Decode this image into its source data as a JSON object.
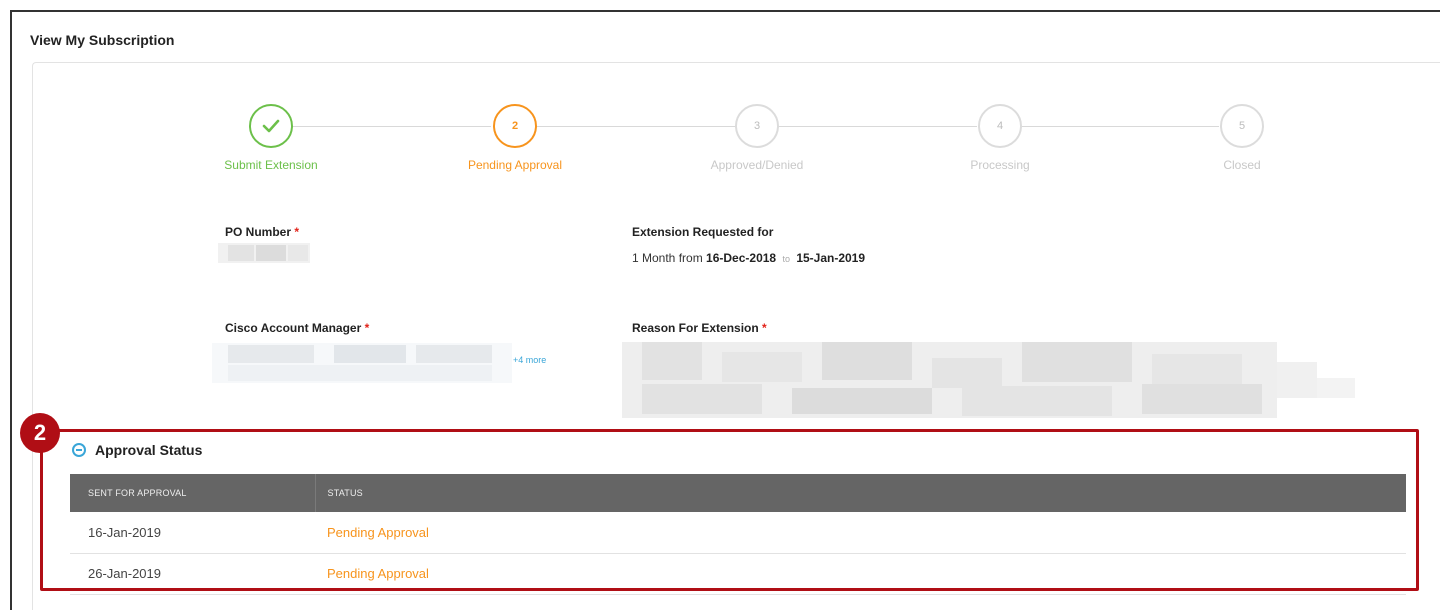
{
  "page": {
    "title": "View My Subscription"
  },
  "stepper": {
    "steps": [
      {
        "number": "",
        "label": "Submit Extension",
        "state": "done",
        "icon": "check-icon"
      },
      {
        "number": "2",
        "label": "Pending Approval",
        "state": "active"
      },
      {
        "number": "3",
        "label": "Approved/Denied",
        "state": "pending"
      },
      {
        "number": "4",
        "label": "Processing",
        "state": "pending"
      },
      {
        "number": "5",
        "label": "Closed",
        "state": "pending"
      }
    ]
  },
  "fields": {
    "po_number": {
      "label": "PO Number",
      "required": "*"
    },
    "extension": {
      "label": "Extension Requested for",
      "prefix": "1 Month from",
      "start": "16-Dec-2018",
      "to": "to",
      "end": "15-Jan-2019"
    },
    "account_manager": {
      "label": "Cisco Account Manager",
      "required": "*",
      "more": "+4 more"
    },
    "reason": {
      "label": "Reason For Extension",
      "required": "*"
    }
  },
  "callout": {
    "badge": "2"
  },
  "approval": {
    "title": "Approval Status",
    "columns": [
      "SENT FOR APPROVAL",
      "STATUS"
    ],
    "rows": [
      {
        "sent": "16-Jan-2019",
        "status": "Pending Approval"
      },
      {
        "sent": "26-Jan-2019",
        "status": "Pending Approval"
      }
    ]
  },
  "colors": {
    "done": "#6cc04a",
    "active": "#f7941d",
    "inactive": "#c8c8c8",
    "callout": "#b00e15",
    "link": "#3aa6d8",
    "table_header": "#656565"
  }
}
